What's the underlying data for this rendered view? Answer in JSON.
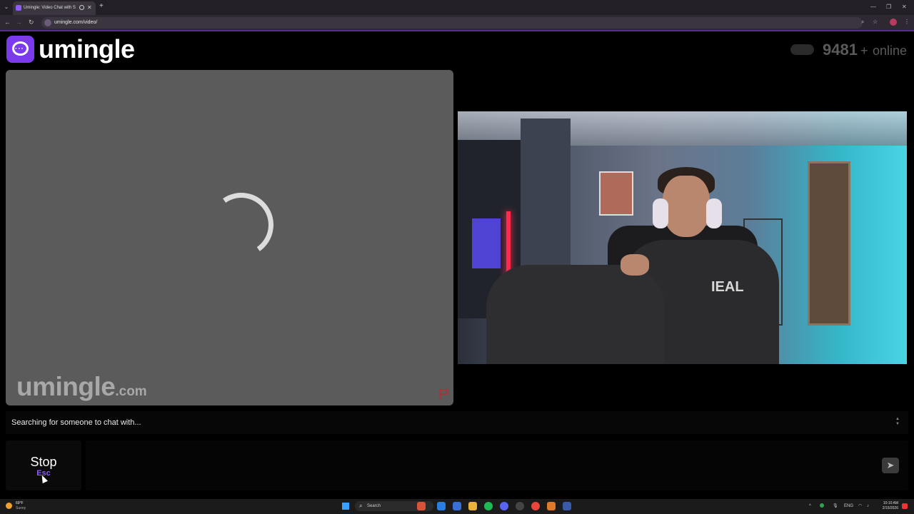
{
  "browser": {
    "tab_title": "Umingle: Video Chat with S",
    "tab_close": "✕",
    "new_tab": "+",
    "url": "umingle.com/video/",
    "nav_back": "←",
    "nav_forward": "→",
    "nav_reload": "↻",
    "window_min": "—",
    "window_restore": "❐",
    "window_close": "✕",
    "zoom_icon": "⌕",
    "star_icon": "☆",
    "menu_icon": "⋮"
  },
  "site": {
    "logo_text": "umingle",
    "online_count": "9481",
    "online_plus": "+",
    "online_label": "online"
  },
  "stranger_panel": {
    "watermark_main": "umingle",
    "watermark_suffix": ".com"
  },
  "self_video": {
    "hoodie_text": "IEAL"
  },
  "status": {
    "text": "Searching for someone to chat with..."
  },
  "controls": {
    "stop_label": "Stop",
    "stop_shortcut": "Esc",
    "send_icon": "➤"
  },
  "taskbar": {
    "weather_temp": "69°F",
    "weather_desc": "Sunny",
    "search_label": "Search",
    "search_icon": "⌕",
    "tray_lang": "ENG",
    "tray_up": "^",
    "clock_time": "10:10 AM",
    "clock_date": "2/15/2026"
  },
  "colors": {
    "brand": "#7c3aed",
    "accent": "#8b5cf6",
    "panel": "#5a5b5a"
  }
}
